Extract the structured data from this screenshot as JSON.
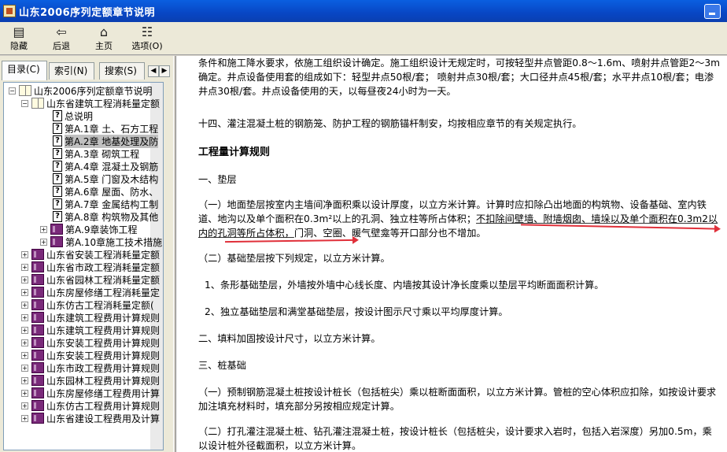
{
  "window": {
    "title": "山东2006序列定额章节说明"
  },
  "toolbar": {
    "hide_label": "隐藏",
    "back_label": "后退",
    "home_label": "主页",
    "options_label": "选项(O)"
  },
  "nav_tabs": {
    "contents": "目录(C)",
    "index": "索引(N)",
    "search": "搜索(S)"
  },
  "tree": [
    {
      "label": "山东2006序列定额章节说明",
      "type": "book-open",
      "expander": "−",
      "level": 0
    },
    {
      "label": "山东省建筑工程消耗量定额",
      "type": "book-open",
      "expander": "−",
      "level": 1
    },
    {
      "label": "总说明",
      "type": "page",
      "level": 2
    },
    {
      "label": "第A.1章 土、石方工程",
      "type": "page",
      "level": 2
    },
    {
      "label": "第A.2章 地基处理及防",
      "type": "page",
      "level": 2,
      "selected": true
    },
    {
      "label": "第A.3章 砌筑工程",
      "type": "page",
      "level": 2
    },
    {
      "label": "第A.4章 混凝土及钢筋",
      "type": "page",
      "level": 2
    },
    {
      "label": "第A.5章 门窗及木结构",
      "type": "page",
      "level": 2
    },
    {
      "label": "第A.6章 屋面、防水、",
      "type": "page",
      "level": 2
    },
    {
      "label": "第A.7章 金属结构工制",
      "type": "page",
      "level": 2
    },
    {
      "label": "第A.8章 构筑物及其他",
      "type": "page",
      "level": 2
    },
    {
      "label": "第A.9章装饰工程",
      "type": "book",
      "expander": "+",
      "level": 2
    },
    {
      "label": "第A.10章施工技术措施",
      "type": "book",
      "expander": "+",
      "level": 2
    },
    {
      "label": "山东省安装工程消耗量定额",
      "type": "book",
      "expander": "+",
      "level": 1
    },
    {
      "label": "山东省市政工程消耗量定额",
      "type": "book",
      "expander": "+",
      "level": 1
    },
    {
      "label": "山东省园林工程消耗量定额",
      "type": "book",
      "expander": "+",
      "level": 1
    },
    {
      "label": "山东房屋修缮工程消耗量定",
      "type": "book",
      "expander": "+",
      "level": 1
    },
    {
      "label": "山东仿古工程消耗量定额(",
      "type": "book",
      "expander": "+",
      "level": 1
    },
    {
      "label": "山东建筑工程费用计算规则",
      "type": "book",
      "expander": "+",
      "level": 1
    },
    {
      "label": "山东建筑工程费用计算规则",
      "type": "book",
      "expander": "+",
      "level": 1
    },
    {
      "label": "山东安装工程费用计算规则",
      "type": "book",
      "expander": "+",
      "level": 1
    },
    {
      "label": "山东安装工程费用计算规则",
      "type": "book",
      "expander": "+",
      "level": 1
    },
    {
      "label": "山东市政工程费用计算规则",
      "type": "book",
      "expander": "+",
      "level": 1
    },
    {
      "label": "山东园林工程费用计算规则",
      "type": "book",
      "expander": "+",
      "level": 1
    },
    {
      "label": "山东房屋修缮工程费用计算",
      "type": "book",
      "expander": "+",
      "level": 1
    },
    {
      "label": "山东仿古工程费用计算规则",
      "type": "book",
      "expander": "+",
      "level": 1
    },
    {
      "label": "山东省建设工程费用及计算",
      "type": "book",
      "expander": "+",
      "level": 1
    }
  ],
  "content": {
    "p1": "条件和施工降水要求，依施工组织设计确定。施工组织设计无规定时，可按轻型井点管距0.8～1.6m、喷射井点管距2～3m确定。井点设备使用套的组成如下：轻型井点50根/套； 喷射井点30根/套；大口径井点45根/套；水平井点10根/套；电渗井点30根/套。井点设备使用的天，以每昼夜24小时为一天。",
    "p2": "十四、灌注混凝土桩的钢筋笼、防护工程的钢筋锚杆制安，均按相应章节的有关规定执行。",
    "h1": "工程量计算规则",
    "p3": "一、垫层",
    "p4a": "（一）地面垫层按室内主墙间净面积乘以设计厚度，以立方米计算。计算时应扣除凸出地面的构筑物、设备基础、室内铁道、地沟以及单个面积在0.3m²以上的孔洞、独立柱等所占体积；",
    "p4b": "不扣除间壁墙、附墙烟囱、墙垛以及单个面积在0.3m2以内的孔洞等所占体积，",
    "p4c": "门洞、空圈、暖气壁龛等开口部分也不增加。",
    "p5": "（二）基础垫层按下列规定，以立方米计算。",
    "p6": "1、条形基础垫层，外墙按外墙中心线长度、内墙按其设计净长度乘以垫层平均断面面积计算。",
    "p7": "2、独立基础垫层和满堂基础垫层，按设计图示尺寸乘以平均厚度计算。",
    "p8": "二、填料加固按设计尺寸，以立方米计算。",
    "p9": "三、桩基础",
    "p10": "（一）预制钢筋混凝土桩按设计桩长（包括桩尖）乘以桩断面面积，以立方米计算。管桩的空心体积应扣除，如按设计要求加注填充材料时，填充部分另按相应规定计算。",
    "p11": "（二）打孔灌注混凝土桩、钻孔灌注混凝土桩，按设计桩长（包括桩尖，设计要求入岩时，包括入岩深度）另加0.5m，乘以设计桩外径截面积，以立方米计算。"
  }
}
